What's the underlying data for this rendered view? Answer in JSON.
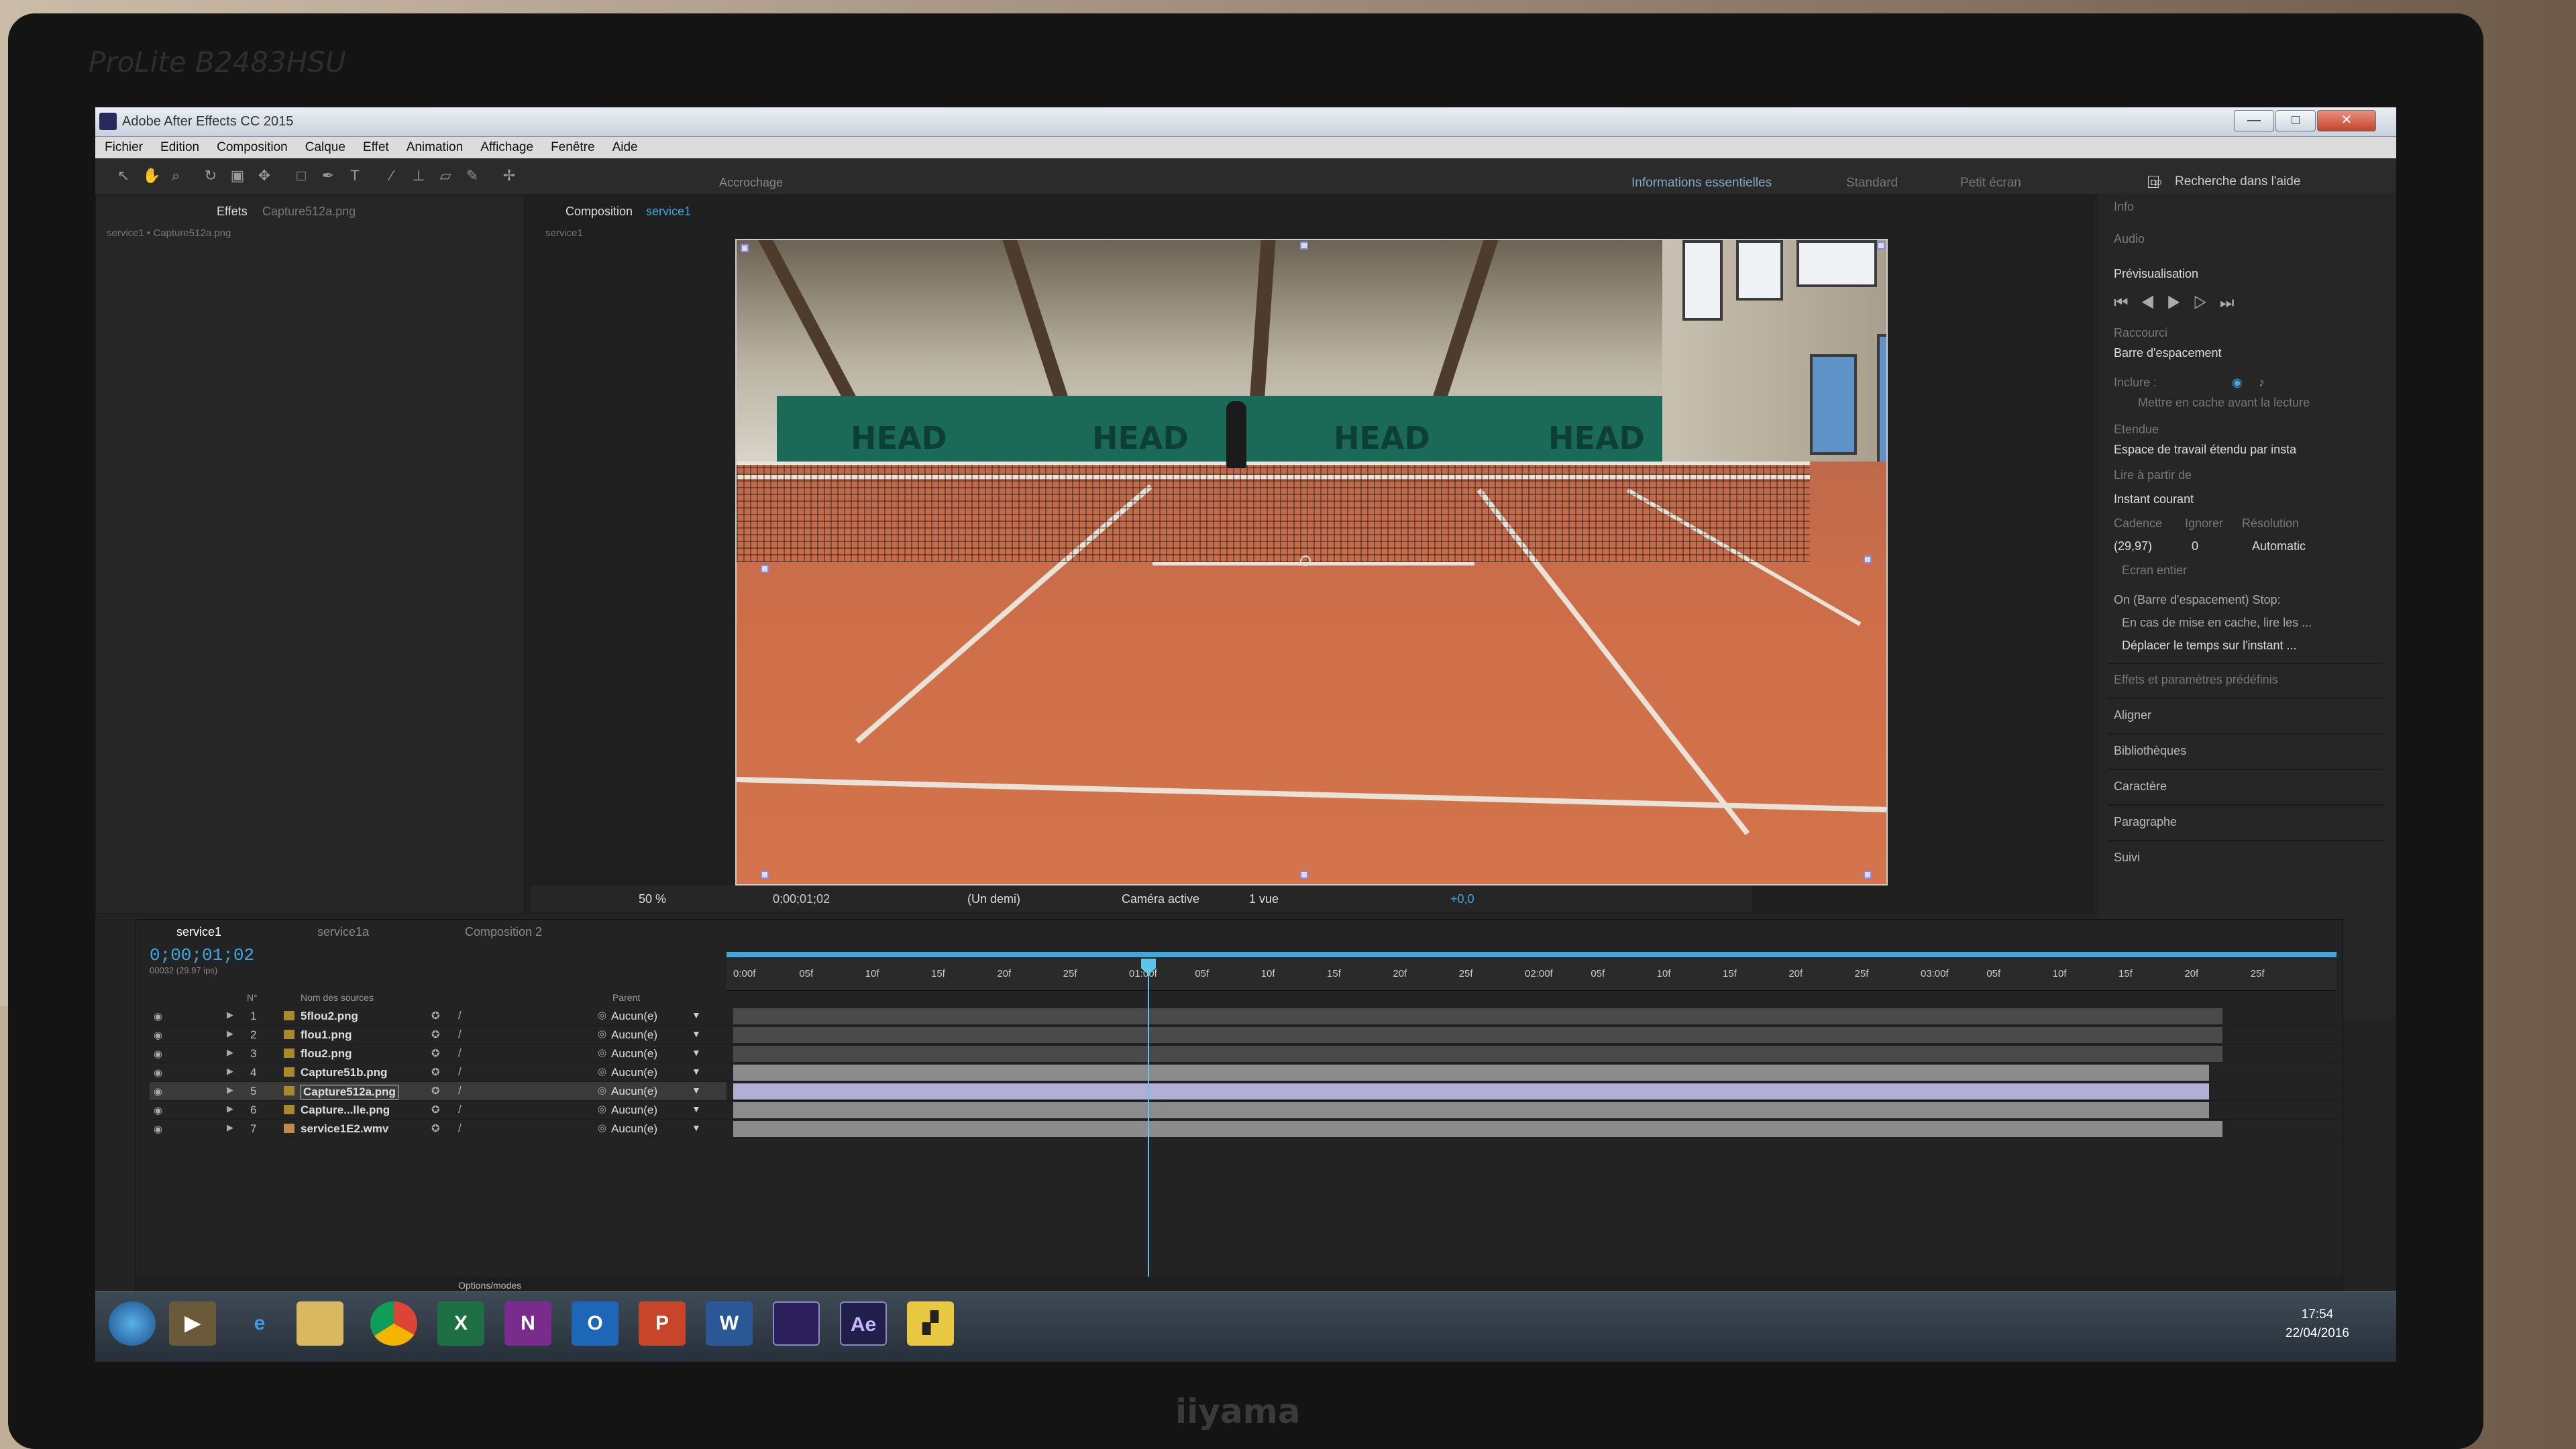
{
  "monitor": {
    "model": "ProLite B2483HSU",
    "brand": "iiyama"
  },
  "app": {
    "title": "Adobe After Effects CC 2015",
    "window_buttons": {
      "minimize": "—",
      "maximize": "□",
      "close": "✕"
    }
  },
  "menu": [
    "Fichier",
    "Edition",
    "Composition",
    "Calque",
    "Effet",
    "Animation",
    "Affichage",
    "Fenêtre",
    "Aide"
  ],
  "toolbar": {
    "snap_label": "Accrochage",
    "workspaces": [
      "Informations essentielles",
      "Standard",
      "Petit écran"
    ],
    "search_help": "Recherche dans l'aide"
  },
  "project_panel": {
    "tab": "Effets",
    "tab_file": "Capture512a.png",
    "crumb": "service1 • Capture512a.png"
  },
  "composition_panel": {
    "tab": "Composition",
    "tab_name": "service1",
    "crumb": "service1"
  },
  "footage": {
    "banner_words": [
      "HEAD",
      "HEAD",
      "HEAD",
      "HEAD"
    ]
  },
  "viewer_footer": {
    "zoom": "50 %",
    "timecode": "0;00;01;02",
    "resolution": "(Un demi)",
    "camera": "Caméra active",
    "views": "1 vue",
    "exposure": "+0,0"
  },
  "right_panel": {
    "info": "Info",
    "audio": "Audio",
    "preview_title": "Prévisualisation",
    "shortcut_label": "Raccourci",
    "shortcut_value": "Barre d'espacement",
    "include_label": "Inclure :",
    "cache_label": "Mettre en cache avant la lecture",
    "range_label": "Etendue",
    "range_value": "Espace de travail étendu par insta",
    "play_from_label": "Lire à partir de",
    "play_from_value": "Instant courant",
    "framerate_label": "Cadence",
    "skip_label": "Ignorer",
    "resolution_label": "Résolution",
    "framerate_value": "(29,97)",
    "skip_value": "0",
    "resolution_value": "Automatic",
    "fullscreen": "Ecran entier",
    "stop_label": "On (Barre d'espacement) Stop:",
    "stop_opt1": "En cas de mise en cache, lire les ...",
    "stop_opt2": "Déplacer le temps sur l'instant ...",
    "sections": [
      "Effets et paramètres prédéfinis",
      "Aligner",
      "Bibliothèques",
      "Caractère",
      "Paragraphe",
      "Suivi"
    ]
  },
  "timeline": {
    "tabs": [
      "service1",
      "service1a",
      "Composition 2"
    ],
    "timecode": "0;00;01;02",
    "timecode_sub": "00032 (29.97 ips)",
    "columns": {
      "num": "N°",
      "source": "Nom des sources",
      "parent": "Parent"
    },
    "ruler": [
      "0:00f",
      "05f",
      "10f",
      "15f",
      "20f",
      "25f",
      "01:00f",
      "05f",
      "10f",
      "15f",
      "20f",
      "25f",
      "02:00f",
      "05f",
      "10f",
      "15f",
      "20f",
      "25f",
      "03:00f",
      "05f",
      "10f",
      "15f",
      "20f",
      "25f"
    ],
    "layers": [
      {
        "num": "1",
        "name": "5flou2.png",
        "parent": "Aucun(e)"
      },
      {
        "num": "2",
        "name": "flou1.png",
        "parent": "Aucun(e)"
      },
      {
        "num": "3",
        "name": "flou2.png",
        "parent": "Aucun(e)"
      },
      {
        "num": "4",
        "name": "Capture51b.png",
        "parent": "Aucun(e)"
      },
      {
        "num": "5",
        "name": "Capture512a.png",
        "parent": "Aucun(e)"
      },
      {
        "num": "6",
        "name": "Capture...lle.png",
        "parent": "Aucun(e)"
      },
      {
        "num": "7",
        "name": "service1E2.wmv",
        "parent": "Aucun(e)"
      }
    ],
    "footer": "Options/modes"
  },
  "taskbar": {
    "apps": [
      "start",
      "media-player",
      "internet-explorer",
      "explorer",
      "chrome",
      "excel",
      "onenote",
      "outlook",
      "powerpoint",
      "word",
      "premiere",
      "after-effects",
      "clapper"
    ],
    "app_letters": {
      "excel": "X",
      "onenote": "N",
      "outlook": "O",
      "powerpoint": "P",
      "word": "W",
      "after-effects": "Ae"
    },
    "time": "17:54",
    "date": "22/04/2016"
  }
}
